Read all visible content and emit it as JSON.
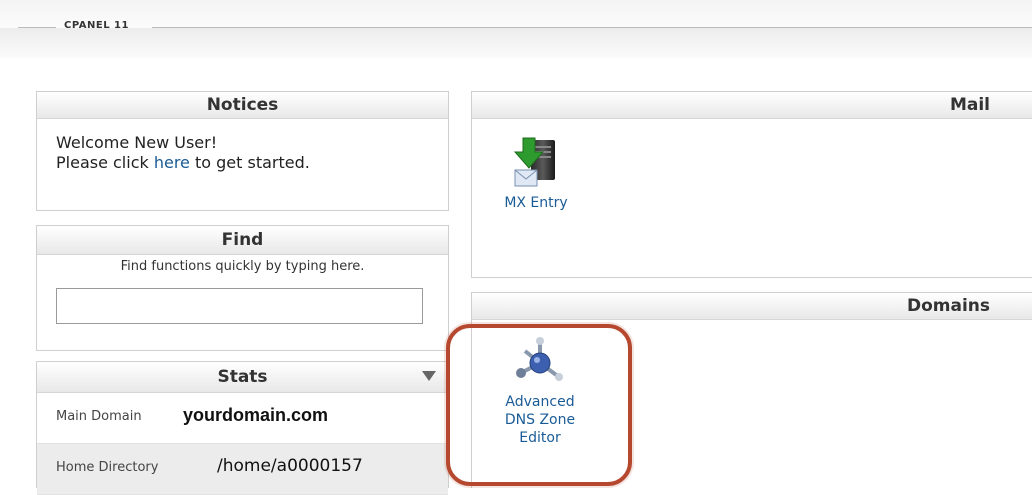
{
  "header": {
    "title": "CPANEL 11"
  },
  "notices": {
    "title": "Notices",
    "line1": "Welcome New User!",
    "line2_before": "Please click ",
    "line2_link": "here",
    "line2_after": " to get started."
  },
  "find": {
    "title": "Find",
    "hint": "Find functions quickly by typing here.",
    "input_value": ""
  },
  "stats": {
    "title": "Stats",
    "rows": [
      {
        "label": "Main Domain",
        "value": "yourdomain.com"
      },
      {
        "label": "Home Directory",
        "value": "/home/a0000157"
      }
    ]
  },
  "mail": {
    "title": "Mail",
    "apps": [
      {
        "label": "MX Entry",
        "icon": "mx-entry-icon"
      }
    ]
  },
  "domains": {
    "title": "Domains",
    "apps": [
      {
        "label_lines": [
          "Advanced",
          "DNS Zone",
          "Editor"
        ],
        "icon": "dns-zone-editor-icon"
      }
    ]
  },
  "colors": {
    "link": "#1a5b96",
    "highlight": "#b5482f"
  }
}
